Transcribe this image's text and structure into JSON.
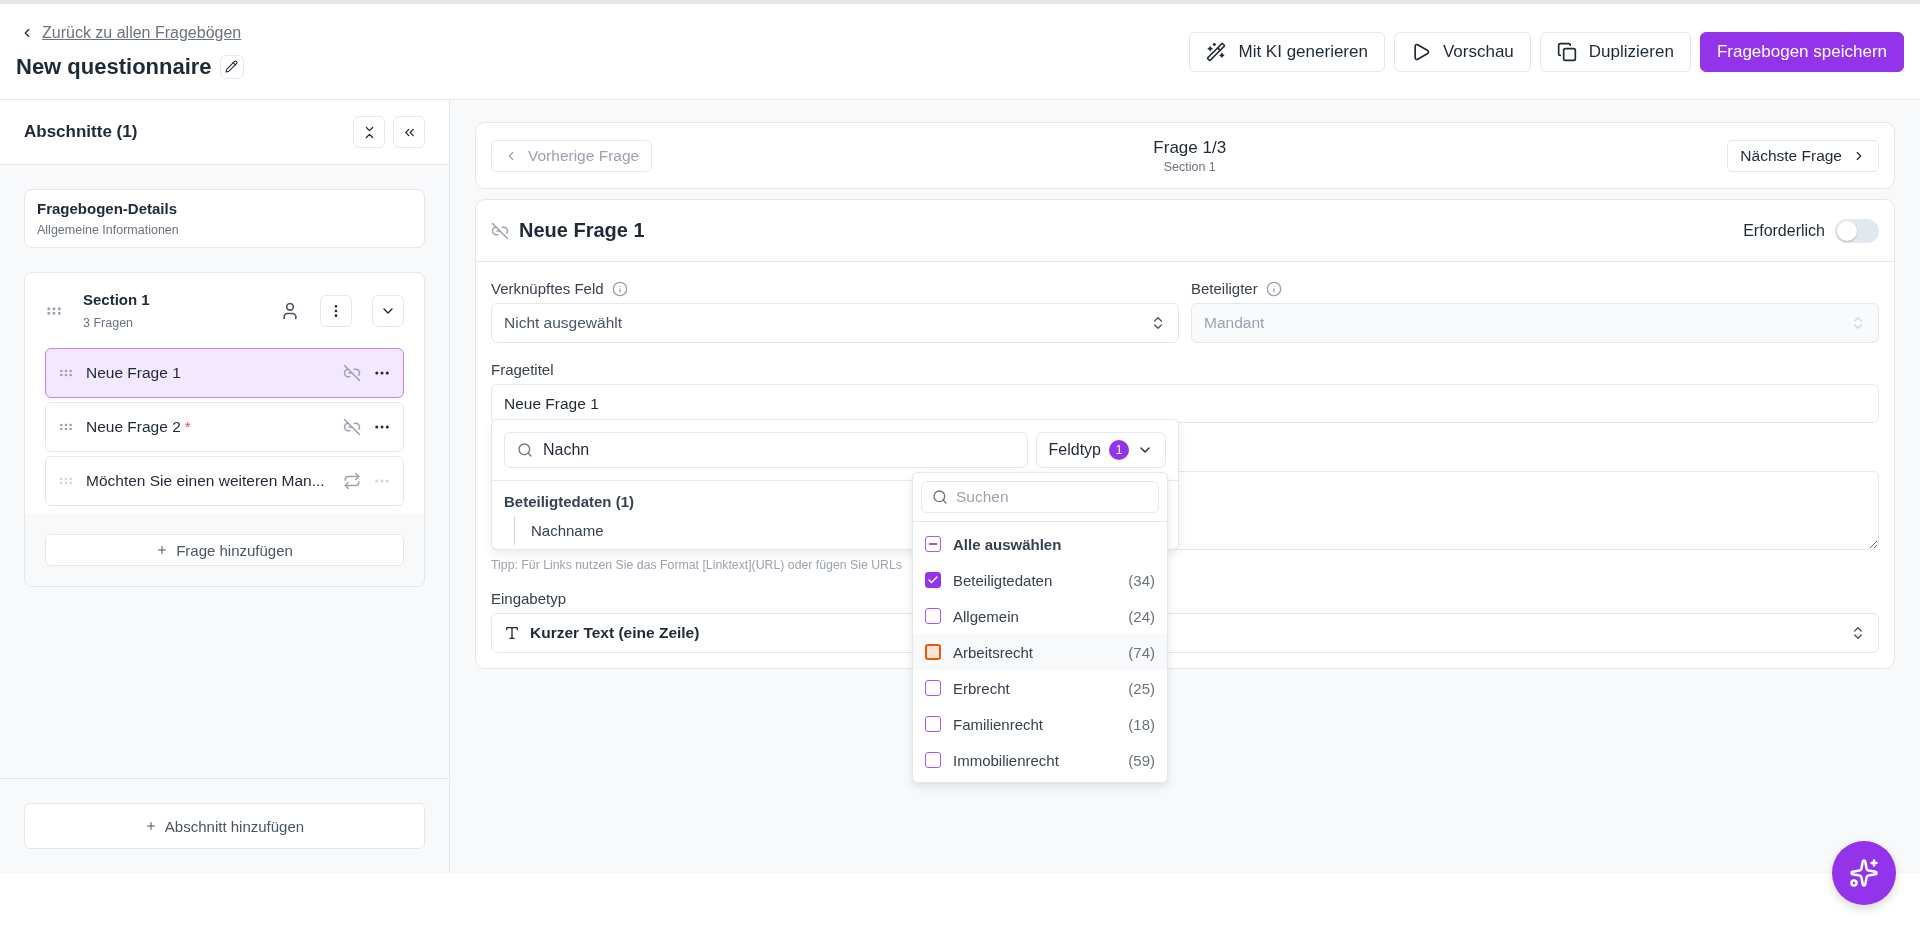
{
  "header": {
    "back_link": "Zurück zu allen Fragebögen",
    "title": "New questionnaire",
    "actions": [
      {
        "kind": "wand",
        "label": "Mit KI generieren",
        "primary": false
      },
      {
        "kind": "play",
        "label": "Vorschau",
        "primary": false
      },
      {
        "kind": "copy",
        "label": "Duplizieren",
        "primary": false
      },
      {
        "kind": "none",
        "label": "Fragebogen speichern",
        "primary": true
      }
    ]
  },
  "sidebar": {
    "title": "Abschnitte (1)",
    "details": {
      "title": "Fragebogen-Details",
      "subtitle": "Allgemeine Informationen"
    },
    "sections": [
      {
        "title": "Section 1",
        "subtitle": "3 Fragen",
        "expanded": true,
        "required_mark": "*",
        "questions": [
          {
            "label": "Neue Frage 1",
            "selected": true,
            "required": false,
            "kind": "unlinked"
          },
          {
            "label": "Neue Frage 2",
            "selected": false,
            "required": true,
            "kind": "unlinked"
          },
          {
            "label": "Möchten Sie einen weiteren Man...",
            "selected": false,
            "required": false,
            "kind": "repeat"
          }
        ],
        "add_question": "Frage hinzufügen"
      }
    ],
    "add_section": "Abschnitt hinzufügen"
  },
  "nav": {
    "previous": {
      "label": "Vorherige Frage",
      "disabled": true
    },
    "counter": "Frage 1/3",
    "section": "Section 1",
    "next": {
      "label": "Nächste Frage",
      "disabled": false
    }
  },
  "question": {
    "title": "Neue Frage 1",
    "required_label": "Erforderlich",
    "required_on": false,
    "linked_field": {
      "label": "Verknüpftes Feld",
      "value": "Nicht ausgewählt",
      "disabled": false
    },
    "participant": {
      "label": "Beteiligter",
      "value": "Mandant",
      "disabled": true
    },
    "title_field": {
      "label": "Fragetitel",
      "value": "Neue Frage 1"
    },
    "tip": "Tipp: Für Links nutzen Sie das Format [Linktext](URL) oder fügen Sie URLs",
    "input_type": {
      "label": "Eingabetyp",
      "value": "Kurzer Text (eine Zeile)"
    }
  },
  "field_picker": {
    "search_value": "Nachn",
    "filter_label": "Feldtyp",
    "filter_count": "1",
    "groups": [
      {
        "title": "Beteiligtedaten (1)",
        "items": [
          "Nachname"
        ]
      }
    ]
  },
  "type_filter": {
    "search_placeholder": "Suchen",
    "select_all": {
      "label": "Alle auswählen",
      "partial": true
    },
    "options": [
      {
        "label": "Beteiligtedaten",
        "count": "(34)",
        "checked": true,
        "highlighted": false
      },
      {
        "label": "Allgemein",
        "count": "(24)",
        "checked": false,
        "highlighted": false
      },
      {
        "label": "Arbeitsrecht",
        "count": "(74)",
        "checked": false,
        "highlighted": true
      },
      {
        "label": "Erbrecht",
        "count": "(25)",
        "checked": false,
        "highlighted": false
      },
      {
        "label": "Familienrecht",
        "count": "(18)",
        "checked": false,
        "highlighted": false
      },
      {
        "label": "Immobilienrecht",
        "count": "(59)",
        "checked": false,
        "highlighted": false
      }
    ]
  }
}
